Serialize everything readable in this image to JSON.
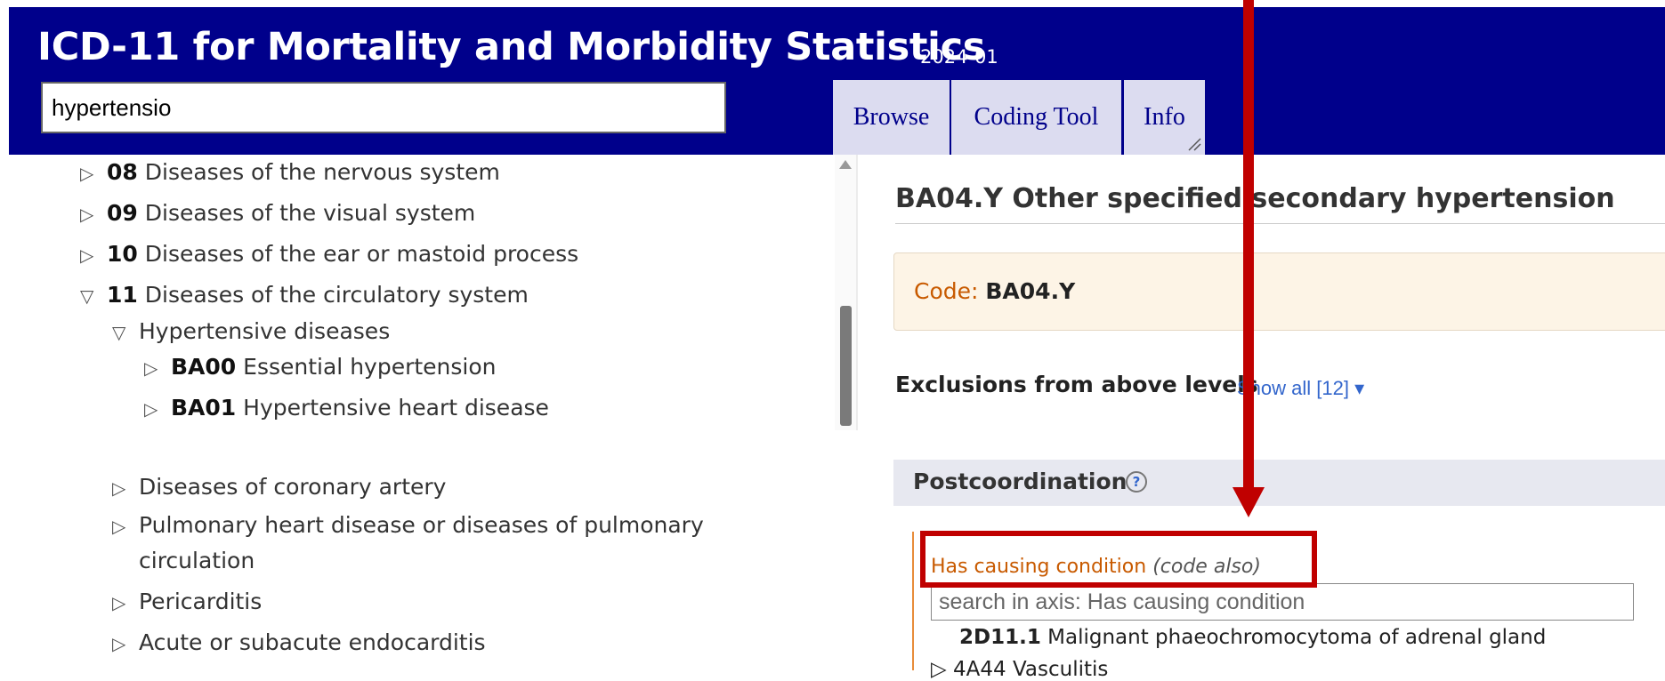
{
  "header": {
    "title": "ICD-11 for Mortality and Morbidity Statistics",
    "version": "2024-01",
    "search_value": "hypertensio",
    "tabs": [
      "Browse",
      "Coding Tool",
      "Info"
    ]
  },
  "tree": {
    "items": [
      {
        "code": "08",
        "label": "Diseases of the nervous system",
        "expanded": false
      },
      {
        "code": "09",
        "label": "Diseases of the visual system",
        "expanded": false
      },
      {
        "code": "10",
        "label": "Diseases of the ear or mastoid process",
        "expanded": false
      },
      {
        "code": "11",
        "label": "Diseases of the circulatory system",
        "expanded": true
      },
      {
        "code": "",
        "label": "Hypertensive diseases",
        "expanded": true
      },
      {
        "code": "BA00",
        "label": "Essential hypertension",
        "expanded": false
      },
      {
        "code": "BA01",
        "label": "Hypertensive heart disease",
        "expanded": false
      },
      {
        "code": "",
        "label": "Diseases of coronary artery",
        "expanded": false
      },
      {
        "code": "",
        "label": "Pulmonary heart disease or diseases of pulmonary",
        "expanded": false
      },
      {
        "code": "",
        "label": "circulation",
        "expanded": false
      },
      {
        "code": "",
        "label": "Pericarditis",
        "expanded": false
      },
      {
        "code": "",
        "label": "Acute or subacute endocarditis",
        "expanded": false
      }
    ],
    "collapsed_glyph": "▷",
    "expanded_glyph": "▽"
  },
  "detail": {
    "title": "BA04.Y Other specified secondary hypertension",
    "code_label": "Code: ",
    "code_value": "BA04.Y",
    "exclusions_label": "Exclusions from above levels",
    "show_all_link": "Show all [12] ▾",
    "postcoordination_label": "Postcoordination",
    "help_glyph": "?",
    "axis": {
      "label": "Has causing condition",
      "note": "(code also)",
      "search_placeholder": "search in axis: Has causing condition",
      "result_1_code": "2D11.1",
      "result_1_label": "Malignant phaeochromocytoma of adrenal gland",
      "result_2_label": "▷  4A44 Vasculitis"
    }
  },
  "colors": {
    "header_bg": "#00008b",
    "tab_bg": "#dcdcf0",
    "code_orange": "#c85a00",
    "annotation_red": "#c00000",
    "link_blue": "#3366cc"
  }
}
